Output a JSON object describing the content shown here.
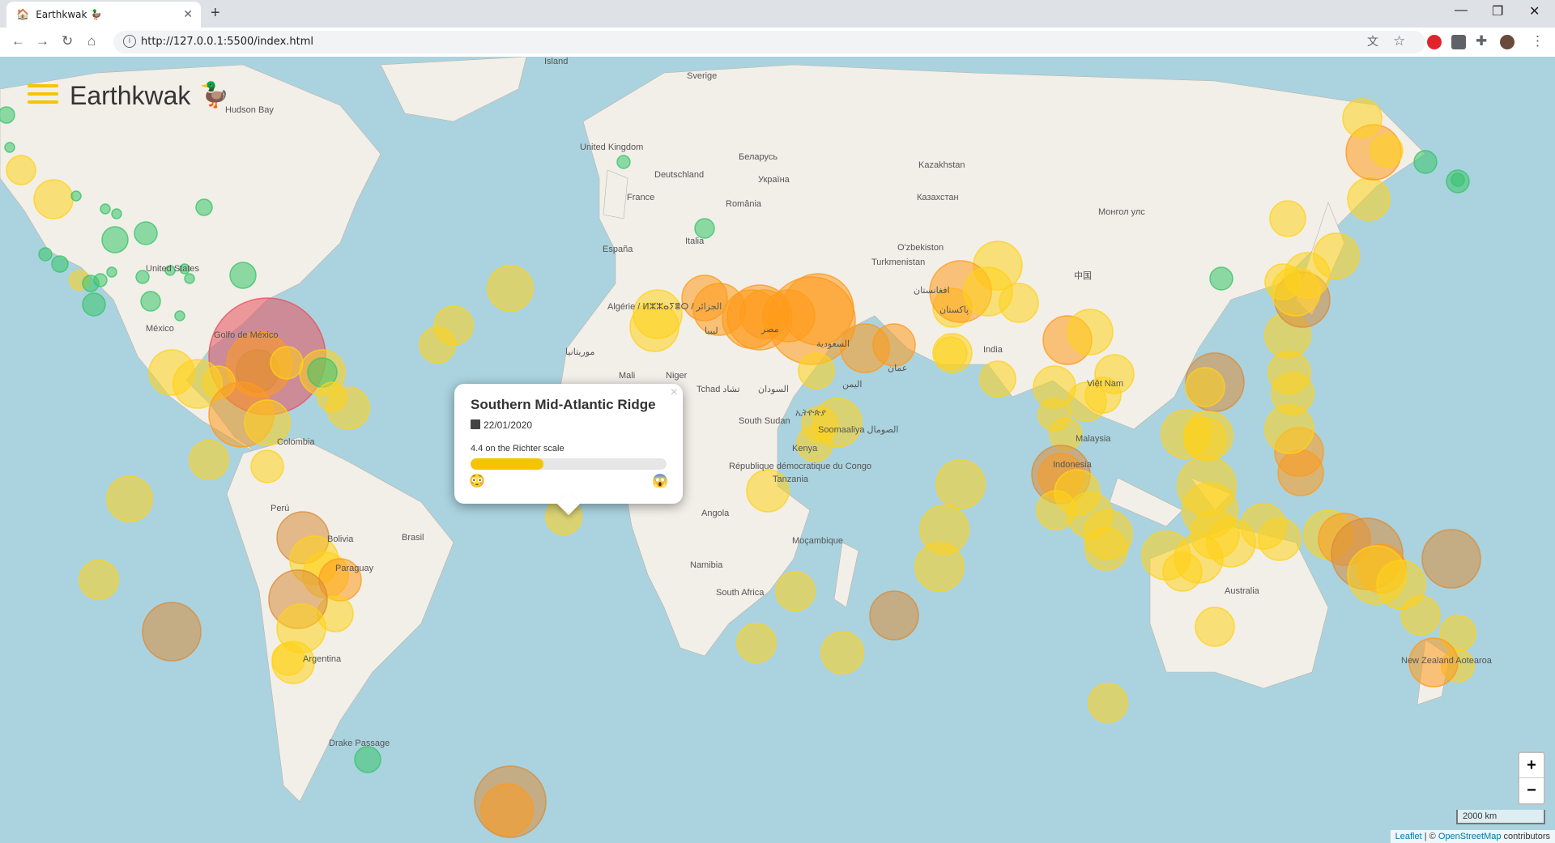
{
  "browser": {
    "tab_title": "Earthkwak 🦆",
    "url": "http://127.0.0.1:5500/index.html",
    "window_controls": [
      "minimize-icon",
      "restore-icon",
      "close-icon"
    ]
  },
  "app": {
    "title": "Earthkwak",
    "logo_icon": "duck-icon",
    "menu_icon": "hamburger-icon"
  },
  "map": {
    "labels": [
      {
        "text": "Island"
      },
      {
        "text": "Sverige"
      },
      {
        "text": "United Kingdom"
      },
      {
        "text": "Deutschland"
      },
      {
        "text": "France"
      },
      {
        "text": "Беларусь"
      },
      {
        "text": "Україна"
      },
      {
        "text": "România"
      },
      {
        "text": "España"
      },
      {
        "text": "Italia"
      },
      {
        "text": "Algérie / ⵍⵣⵣⴰⵢⴻⵔ / الجزائر"
      },
      {
        "text": "ليبيا"
      },
      {
        "text": "مصر"
      },
      {
        "text": "Mali"
      },
      {
        "text": "Niger"
      },
      {
        "text": "Tchad تشاد"
      },
      {
        "text": "السودان"
      },
      {
        "text": "South Sudan"
      },
      {
        "text": "Kenya"
      },
      {
        "text": "Tanzania"
      },
      {
        "text": "République démocratique du Congo"
      },
      {
        "text": "Angola"
      },
      {
        "text": "Namibia"
      },
      {
        "text": "South Africa"
      },
      {
        "text": "Moçambique"
      },
      {
        "text": "Soomaaliya الصومال"
      },
      {
        "text": "ኢትዮጵያ"
      },
      {
        "text": "Казахстан"
      },
      {
        "text": "O'zbekiston"
      },
      {
        "text": "Turkmenistan"
      },
      {
        "text": "افغانستان"
      },
      {
        "text": "پاکستان"
      },
      {
        "text": "India"
      },
      {
        "text": "中国"
      },
      {
        "text": "Монгол улс"
      },
      {
        "text": "Việt Nam"
      },
      {
        "text": "Malaysia"
      },
      {
        "text": "Indonesia"
      },
      {
        "text": "Australia"
      },
      {
        "text": "New Zealand Aotearoa"
      },
      {
        "text": "United States"
      },
      {
        "text": "México"
      },
      {
        "text": "Colombia"
      },
      {
        "text": "Perú"
      },
      {
        "text": "Brasil"
      },
      {
        "text": "Bolivia"
      },
      {
        "text": "Paraguay"
      },
      {
        "text": "Argentina"
      },
      {
        "text": "Hudson Bay"
      },
      {
        "text": "Drake Passage"
      },
      {
        "text": "Golfo de México"
      },
      {
        "text": "موريتانيا"
      },
      {
        "text": "السعودية"
      },
      {
        "text": "اليمن"
      },
      {
        "text": "عمان"
      },
      {
        "text": "Kazakhstan"
      }
    ]
  },
  "popup": {
    "title": "Southern Mid-Atlantic Ridge",
    "date": "22/01/2020",
    "magnitude_text": "4.4 on the Richter scale",
    "magnitude_fraction": 0.37,
    "calendar_icon": "calendar-icon",
    "low_emoji": "😳",
    "high_emoji": "😱",
    "close": "×"
  },
  "zoom": {
    "in": "+",
    "out": "−"
  },
  "scale": "2000 km",
  "attribution": {
    "leaflet": "Leaflet",
    "separator": " | © ",
    "osm": "OpenStreetMap",
    "suffix": " contributors"
  },
  "colors": {
    "green": "#39c46a",
    "yellow": "#ffd21a",
    "orange": "#ff9a1a",
    "brown": "#d98c3a",
    "red": "#e8505b",
    "water": "#aad3df",
    "land": "#f2efe9",
    "bar_fill": "#f5c400"
  }
}
